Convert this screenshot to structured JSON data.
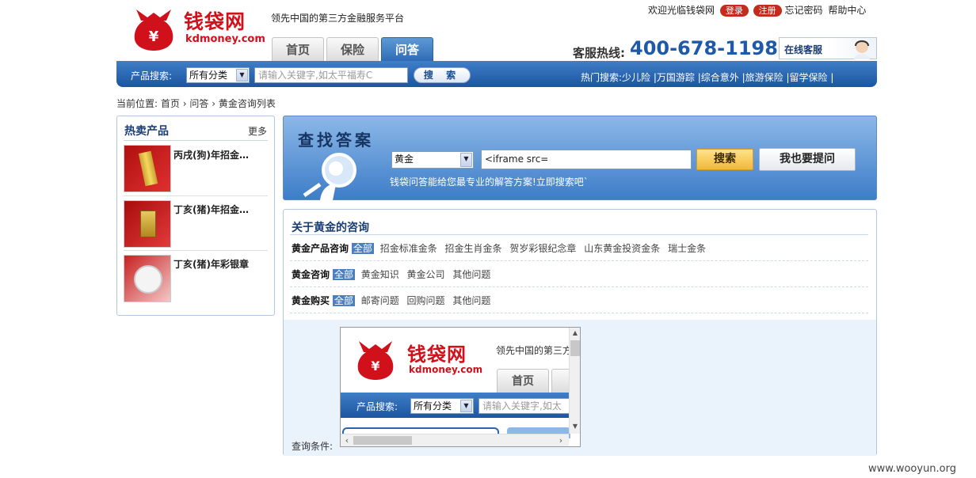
{
  "brand": {
    "name_cn": "钱袋网",
    "name_en": "kdmoney.com",
    "slogan": "领先中国的第三方金融服务平台"
  },
  "top_links": {
    "welcome": "欢迎光临钱袋网",
    "login": "登录",
    "register": "注册",
    "forgot": "忘记密码",
    "help": "帮助中心"
  },
  "tabs": [
    {
      "label": "首页"
    },
    {
      "label": "保险"
    },
    {
      "label": "问答",
      "active": true
    }
  ],
  "hotline": {
    "label": "客服热线:",
    "number": "400-678-1198"
  },
  "online_service": "在线客服",
  "product_search": {
    "label": "产品搜索:",
    "category": "所有分类",
    "placeholder": "请输入关键字,如太平福寿C",
    "button": "搜 索"
  },
  "hot_search": {
    "label": "热门搜索:",
    "items": [
      "少儿险",
      "万国游踪",
      "综合意外",
      "旅游保险",
      "留学保险"
    ]
  },
  "breadcrumb": {
    "prefix": "当前位置:",
    "items": [
      "首页",
      "问答",
      "黄金咨询列表"
    ]
  },
  "hot_products": {
    "title": "热卖产品",
    "more": "更多",
    "items": [
      {
        "name": "丙戌(狗)年招金…"
      },
      {
        "name": "丁亥(猪)年招金…"
      },
      {
        "name": "丁亥(猪)年彩银章"
      }
    ]
  },
  "find_answer": {
    "title": "查找答案",
    "category": "黄金",
    "query": "<iframe src=",
    "search_button": "搜索",
    "ask_button": "我也要提问",
    "tagline": "钱袋问答能给您最专业的解答方案!立即搜索吧`"
  },
  "consult": {
    "title": "关于黄金的咨询",
    "rows": [
      {
        "label": "黄金产品咨询",
        "all": "全部",
        "links": [
          "招金标准金条",
          "招金生肖金条",
          "贺岁彩银纪念章",
          "山东黄金投资金条",
          "瑞士金条"
        ]
      },
      {
        "label": "黄金咨询",
        "all": "全部",
        "links": [
          "黄金知识",
          "黄金公司",
          "其他问题"
        ]
      },
      {
        "label": "黄金购买",
        "all": "全部",
        "links": [
          "邮寄问题",
          "回购问题",
          "其他问题"
        ]
      }
    ],
    "query_conditions": "查询条件:"
  },
  "iframe": {
    "brand_cn": "钱袋网",
    "brand_en": "kdmoney.com",
    "slogan": "领先中国的第三方",
    "tab": "首页",
    "search_label": "产品搜索:",
    "category": "所有分类",
    "placeholder": "请输入关键字,如太"
  },
  "watermark": "www.wooyun.org",
  "colors": {
    "brand_red": "#d0101a",
    "nav_blue": "#2a64ae",
    "accent_yellow": "#f3b73a"
  }
}
